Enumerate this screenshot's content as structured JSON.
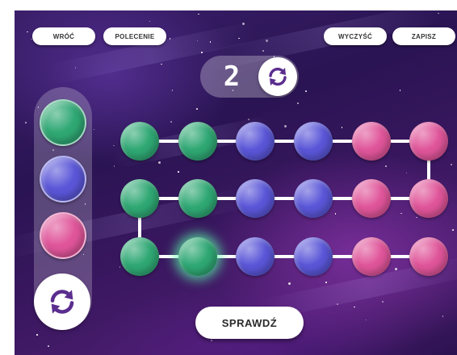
{
  "toolbar": {
    "back_label": "WRÓĆ",
    "instruction_label": "POLECENIE",
    "clear_label": "WYCZYŚĆ",
    "save_label": "ZAPISZ"
  },
  "counter": {
    "value": "2",
    "icon": "refresh-icon"
  },
  "palette": {
    "colors": [
      {
        "name": "green",
        "hex": "#2fa874"
      },
      {
        "name": "blue",
        "hex": "#5a56d8"
      },
      {
        "name": "pink",
        "hex": "#e0559a"
      }
    ],
    "refresh_icon": "refresh-icon"
  },
  "board": {
    "rows": [
      [
        "green",
        "green",
        "blue",
        "blue",
        "pink",
        "pink"
      ],
      [
        "green",
        "green",
        "blue",
        "blue",
        "pink",
        "pink"
      ],
      [
        "green",
        "green",
        "blue",
        "blue",
        "pink",
        "pink"
      ]
    ],
    "highlighted": {
      "row": 2,
      "col": 1
    }
  },
  "check_label": "SPRAWDŹ"
}
